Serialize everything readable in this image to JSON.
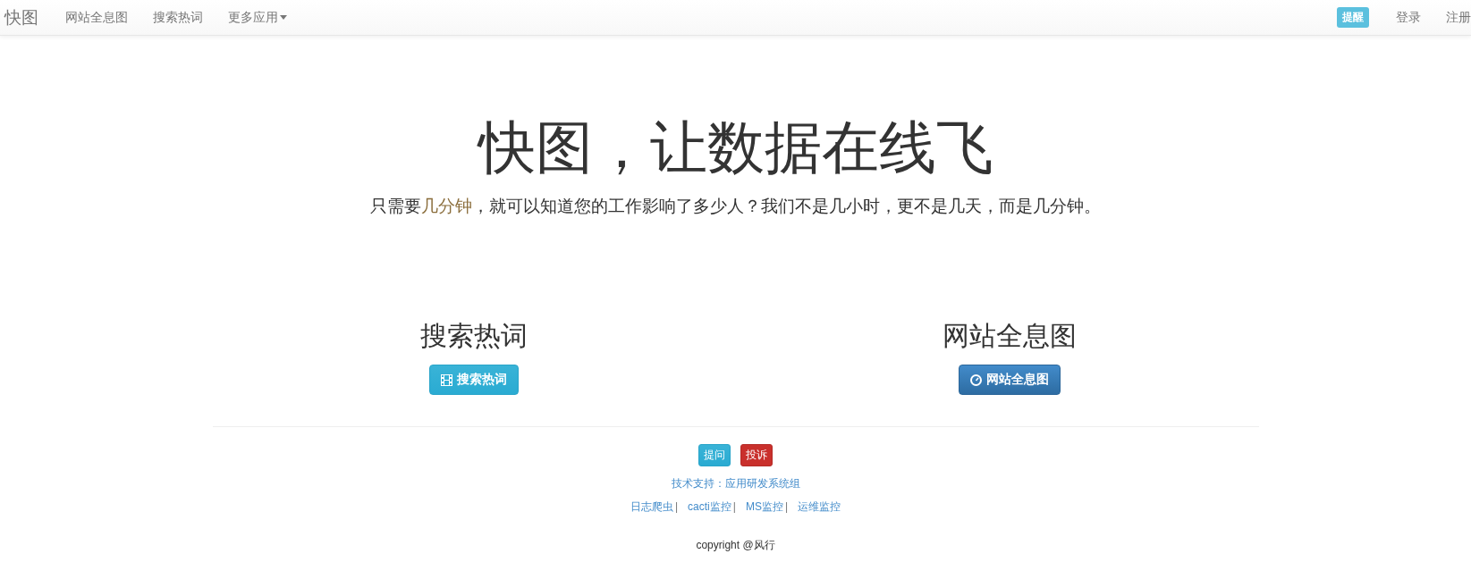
{
  "navbar": {
    "brand": "快图",
    "items": [
      {
        "label": "网站全息图",
        "dropdown": false
      },
      {
        "label": "搜索热词",
        "dropdown": false
      },
      {
        "label": "更多应用",
        "dropdown": true
      }
    ],
    "badge": "提醒",
    "right_links": [
      "登录",
      "注册"
    ]
  },
  "hero": {
    "title": "快图，让数据在线飞",
    "subtitle": {
      "before": "只需要",
      "highlight": "几分钟",
      "after": "，就可以知道您的工作影响了多少人？我们不是几小时，更不是几天，而是几分钟。"
    }
  },
  "features": [
    {
      "heading": "搜索热词",
      "button": "搜索热词",
      "kind": "film"
    },
    {
      "heading": "网站全息图",
      "button": "网站全息图",
      "kind": "dashboard"
    }
  ],
  "footer": {
    "labels": [
      "提问",
      "投诉"
    ],
    "support": "技术支持：应用研发系统组",
    "links": [
      {
        "label": "日志爬虫",
        "separator": "|"
      },
      {
        "label": "cacti监控",
        "separator": "|"
      },
      {
        "label": "MS监控",
        "separator": "|"
      },
      {
        "label": "运维监控"
      }
    ],
    "copyright": "copyright @风行"
  }
}
